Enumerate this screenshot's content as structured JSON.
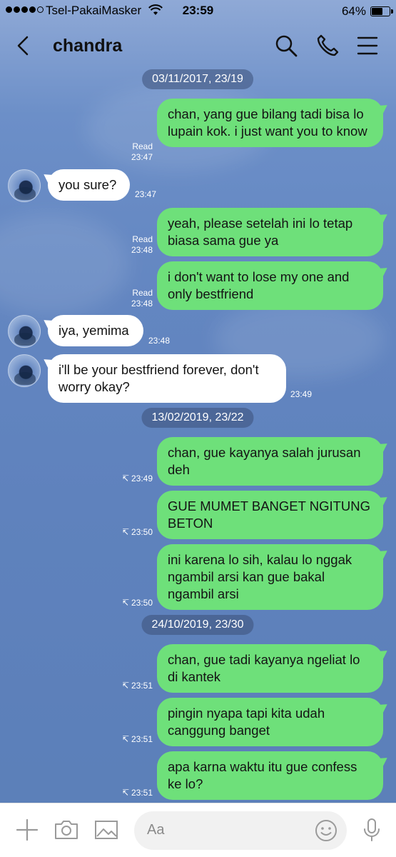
{
  "status_bar": {
    "carrier": "Tsel-PakaiMasker",
    "time": "23:59",
    "battery": "64%",
    "battery_level": 0.64
  },
  "header": {
    "title": "chandra"
  },
  "messages": [
    {
      "type": "date",
      "text": "03/11/2017, 23/19"
    },
    {
      "type": "out",
      "text": "chan, yang gue bilang tadi bisa lo lupain kok. i just want you to know",
      "status": "Read",
      "time": "23:47"
    },
    {
      "type": "in",
      "text": "you sure?",
      "time": "23:47"
    },
    {
      "type": "out",
      "text": "yeah, please setelah ini lo tetap biasa sama gue ya",
      "status": "Read",
      "time": "23:48"
    },
    {
      "type": "out",
      "text": "i don't want to lose my one and only bestfriend",
      "status": "Read",
      "time": "23:48"
    },
    {
      "type": "in",
      "text": "iya, yemima",
      "time": "23:48"
    },
    {
      "type": "in",
      "text": "i'll be your bestfriend forever, don't worry okay?",
      "time": "23:49"
    },
    {
      "type": "date",
      "text": "13/02/2019, 23/22"
    },
    {
      "type": "out",
      "text": "chan, gue kayanya salah jurusan deh",
      "share": "↸",
      "time": "23:49"
    },
    {
      "type": "out",
      "text": "GUE MUMET BANGET NGITUNG BETON",
      "share": "↸",
      "time": "23:50"
    },
    {
      "type": "out",
      "text": "ini karena lo sih, kalau lo nggak ngambil arsi kan gue bakal ngambil arsi",
      "share": "↸",
      "time": "23:50"
    },
    {
      "type": "date",
      "text": "24/10/2019, 23/30"
    },
    {
      "type": "out",
      "text": "chan, gue tadi kayanya ngeliat lo di kantek",
      "share": "↸",
      "time": "23:51"
    },
    {
      "type": "out",
      "text": "pingin nyapa tapi kita udah canggung banget",
      "share": "↸",
      "time": "23:51"
    },
    {
      "type": "out",
      "text": "apa karna waktu itu gue confess ke lo?",
      "share": "↸",
      "time": "23:51"
    }
  ],
  "input": {
    "placeholder": "Aa"
  },
  "icons": {
    "back": "chevron-left-icon",
    "search": "search-icon",
    "call": "phone-icon",
    "menu": "menu-icon",
    "add": "plus-icon",
    "camera": "camera-icon",
    "gallery": "image-icon",
    "emoji": "emoji-icon",
    "mic": "microphone-icon"
  },
  "colors": {
    "outgoing_bubble": "#6ee07a",
    "incoming_bubble": "#ffffff",
    "background": "#5b7fb8"
  }
}
